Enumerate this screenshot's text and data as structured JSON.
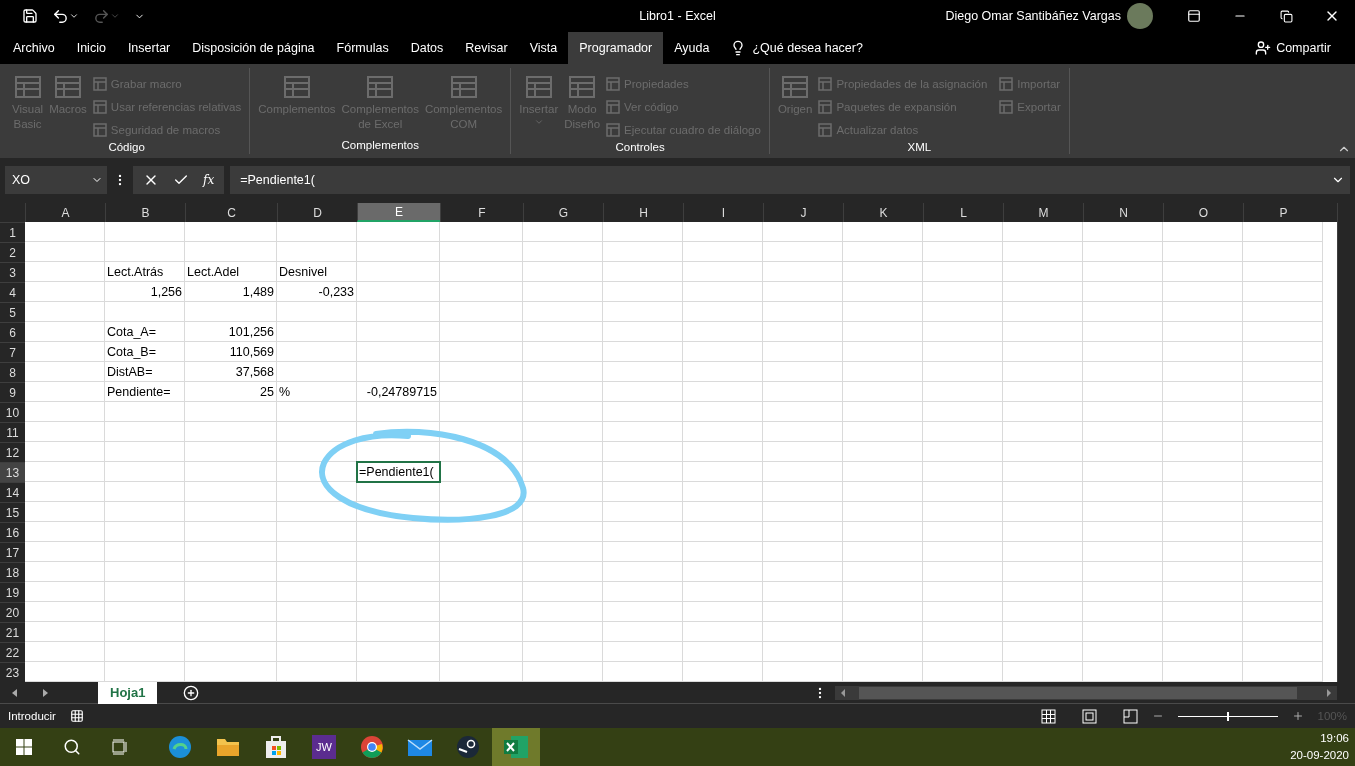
{
  "window": {
    "title": "Libro1  -  Excel",
    "user": "Diego Omar Santibáñez Vargas"
  },
  "menu_tabs": [
    {
      "label": "Archivo",
      "selected": false
    },
    {
      "label": "Inicio",
      "selected": false
    },
    {
      "label": "Insertar",
      "selected": false
    },
    {
      "label": "Disposición de página",
      "selected": false
    },
    {
      "label": "Fórmulas",
      "selected": false
    },
    {
      "label": "Datos",
      "selected": false
    },
    {
      "label": "Revisar",
      "selected": false
    },
    {
      "label": "Vista",
      "selected": false
    },
    {
      "label": "Programador",
      "selected": true
    },
    {
      "label": "Ayuda",
      "selected": false
    }
  ],
  "tell_me": {
    "placeholder": "¿Qué desea hacer?"
  },
  "share_button": "Compartir",
  "ribbon_groups": [
    {
      "label": "Código",
      "items": [
        {
          "kind": "large",
          "label": "Visual\nBasic",
          "disabled": true,
          "dropdown": false
        },
        {
          "kind": "large",
          "label": "Macros",
          "disabled": true,
          "dropdown": false
        },
        {
          "kind": "small",
          "label": "Grabar macro",
          "disabled": true,
          "dropdown": false
        },
        {
          "kind": "small",
          "label": "Usar referencias relativas",
          "disabled": true,
          "dropdown": false
        },
        {
          "kind": "small",
          "label": "Seguridad de macros",
          "disabled": true,
          "dropdown": false
        }
      ]
    },
    {
      "label": "Complementos",
      "items": [
        {
          "kind": "large",
          "label": "Complementos",
          "disabled": true,
          "dropdown": false
        },
        {
          "kind": "large",
          "label": "Complementos\nde Excel",
          "disabled": true,
          "dropdown": false
        },
        {
          "kind": "large",
          "label": "Complementos\nCOM",
          "disabled": true,
          "dropdown": false
        }
      ]
    },
    {
      "label": "Controles",
      "items": [
        {
          "kind": "large",
          "label": "Insertar",
          "disabled": true,
          "dropdown": true
        },
        {
          "kind": "large",
          "label": "Modo\nDiseño",
          "disabled": true,
          "dropdown": false
        },
        {
          "kind": "small",
          "label": "Propiedades",
          "disabled": true,
          "dropdown": false
        },
        {
          "kind": "small",
          "label": "Ver código",
          "disabled": true,
          "dropdown": false
        },
        {
          "kind": "small",
          "label": "Ejecutar cuadro de diálogo",
          "disabled": true,
          "dropdown": false
        }
      ]
    },
    {
      "label": "XML",
      "items": [
        {
          "kind": "large",
          "label": "Origen",
          "disabled": true,
          "dropdown": false
        },
        {
          "kind": "small",
          "label": "Propiedades de la asignación",
          "disabled": true,
          "dropdown": false
        },
        {
          "kind": "small",
          "label": "Paquetes de expansión",
          "disabled": true,
          "dropdown": false
        },
        {
          "kind": "small",
          "label": "Actualizar datos",
          "disabled": true,
          "dropdown": false
        },
        {
          "kind": "small",
          "label": "Importar",
          "disabled": true,
          "dropdown": false
        },
        {
          "kind": "small",
          "label": "Exportar",
          "disabled": true,
          "dropdown": false
        }
      ]
    }
  ],
  "formula_bar": {
    "name_box": "XO",
    "function_label": "fx",
    "formula": "=Pendiente1("
  },
  "grid": {
    "columns": [
      {
        "label": "A",
        "selected": false
      },
      {
        "label": "B",
        "selected": false
      },
      {
        "label": "C",
        "selected": false
      },
      {
        "label": "D",
        "selected": false
      },
      {
        "label": "E",
        "selected": true
      },
      {
        "label": "F",
        "selected": false
      },
      {
        "label": "G",
        "selected": false
      },
      {
        "label": "H",
        "selected": false
      },
      {
        "label": "I",
        "selected": false
      },
      {
        "label": "J",
        "selected": false
      },
      {
        "label": "K",
        "selected": false
      },
      {
        "label": "L",
        "selected": false
      },
      {
        "label": "M",
        "selected": false
      },
      {
        "label": "N",
        "selected": false
      },
      {
        "label": "O",
        "selected": false
      },
      {
        "label": "P",
        "selected": false
      }
    ],
    "rows": [
      {
        "label": "1",
        "selected": false,
        "cells": []
      },
      {
        "label": "2",
        "selected": false,
        "cells": []
      },
      {
        "label": "3",
        "selected": false,
        "cells": [
          null,
          {
            "text": "Lect.Atrás",
            "kind": "text"
          },
          {
            "text": "Lect.Adel",
            "kind": "text"
          },
          {
            "text": "Desnivel",
            "kind": "text"
          }
        ]
      },
      {
        "label": "4",
        "selected": false,
        "cells": [
          null,
          {
            "text": "1,256",
            "kind": "number"
          },
          {
            "text": "1,489",
            "kind": "number"
          },
          {
            "text": "-0,233",
            "kind": "number"
          }
        ]
      },
      {
        "label": "5",
        "selected": false,
        "cells": []
      },
      {
        "label": "6",
        "selected": false,
        "cells": [
          null,
          {
            "text": "Cota_A=",
            "kind": "text"
          },
          {
            "text": "101,256",
            "kind": "number"
          }
        ]
      },
      {
        "label": "7",
        "selected": false,
        "cells": [
          null,
          {
            "text": "Cota_B=",
            "kind": "text"
          },
          {
            "text": "110,569",
            "kind": "number"
          }
        ]
      },
      {
        "label": "8",
        "selected": false,
        "cells": [
          null,
          {
            "text": "DistAB=",
            "kind": "text"
          },
          {
            "text": "37,568",
            "kind": "number"
          }
        ]
      },
      {
        "label": "9",
        "selected": false,
        "cells": [
          null,
          {
            "text": "Pendiente=",
            "kind": "text"
          },
          {
            "text": "25",
            "kind": "number"
          },
          {
            "text": "%",
            "kind": "text"
          },
          {
            "text": "-0,24789715",
            "kind": "number"
          }
        ]
      },
      {
        "label": "10",
        "selected": false,
        "cells": []
      },
      {
        "label": "11",
        "selected": false,
        "cells": []
      },
      {
        "label": "12",
        "selected": false,
        "cells": []
      },
      {
        "label": "13",
        "selected": true,
        "cells": [
          null,
          null,
          null,
          null,
          {
            "text": "=Pendiente1(",
            "kind": "text"
          }
        ]
      },
      {
        "label": "14",
        "selected": false,
        "cells": []
      },
      {
        "label": "15",
        "selected": false,
        "cells": []
      },
      {
        "label": "16",
        "selected": false,
        "cells": []
      },
      {
        "label": "17",
        "selected": false,
        "cells": []
      },
      {
        "label": "18",
        "selected": false,
        "cells": []
      },
      {
        "label": "19",
        "selected": false,
        "cells": []
      },
      {
        "label": "20",
        "selected": false,
        "cells": []
      },
      {
        "label": "21",
        "selected": false,
        "cells": []
      },
      {
        "label": "22",
        "selected": false,
        "cells": []
      },
      {
        "label": "23",
        "selected": false,
        "cells": []
      }
    ]
  },
  "sheet_tabs": [
    {
      "label": "Hoja1",
      "selected": true
    }
  ],
  "status_bar": {
    "mode": "Introducir",
    "zoom": {
      "level": 0.5,
      "reading": "100%"
    }
  },
  "taskbar": {
    "apps": [
      {
        "kind": "edge",
        "selected": false
      },
      {
        "kind": "folder",
        "selected": false
      },
      {
        "kind": "store",
        "selected": false
      },
      {
        "kind": "text",
        "label": "JW",
        "selected": false
      },
      {
        "kind": "chrome",
        "selected": false
      },
      {
        "kind": "mail",
        "selected": false
      },
      {
        "kind": "steam",
        "selected": false
      },
      {
        "kind": "excel",
        "selected": true
      }
    ],
    "time": "19:06",
    "date": "20-09-2020"
  }
}
